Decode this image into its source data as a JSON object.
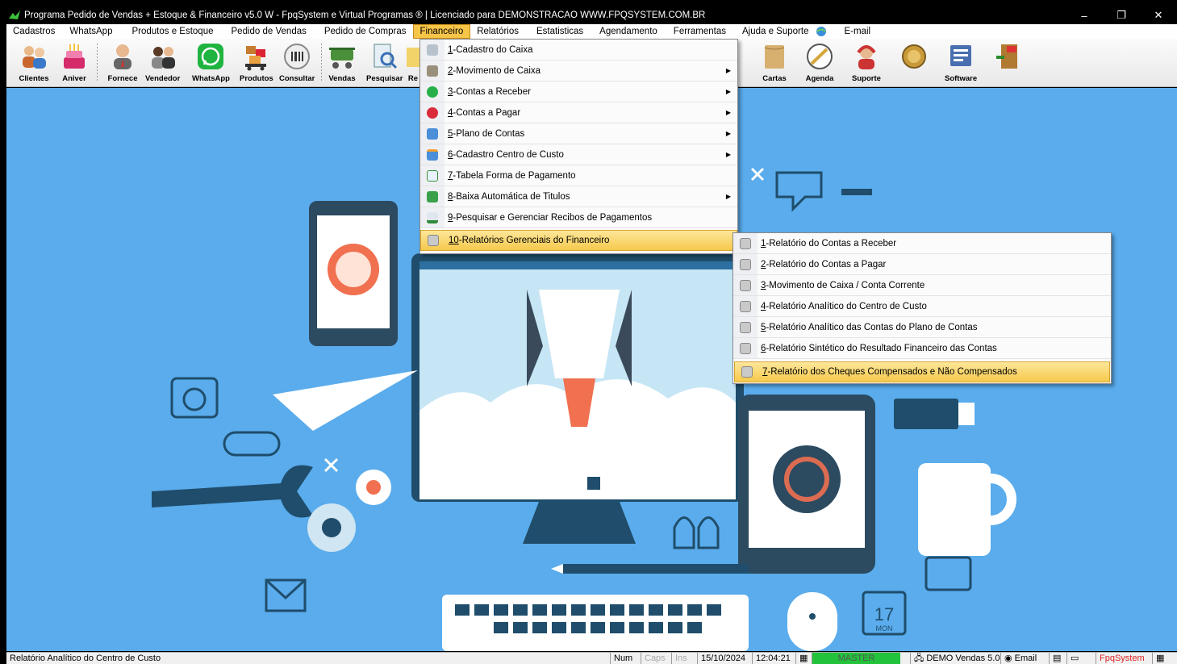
{
  "window": {
    "title": "Programa Pedido de Vendas + Estoque & Financeiro v5.0 W - FpqSystem e Virtual Programas ® | Licenciado para  DEMONSTRACAO WWW.FPQSYSTEM.COM.BR",
    "minimize": "–",
    "maximize": "❐",
    "close": "✕"
  },
  "menubar": [
    {
      "label": "Cadastros"
    },
    {
      "label": "WhatsApp"
    },
    {
      "label": "Produtos e Estoque"
    },
    {
      "label": "Pedido de Vendas"
    },
    {
      "label": "Pedido de Compras"
    },
    {
      "label": "Financeiro"
    },
    {
      "label": "Relatórios"
    },
    {
      "label": "Estatisticas"
    },
    {
      "label": "Agendamento"
    },
    {
      "label": "Ferramentas"
    },
    {
      "label": "Ajuda e Suporte"
    },
    {
      "label": "E-mail"
    }
  ],
  "toolbar": [
    {
      "label": "Clientes",
      "icon": "clients-icon"
    },
    {
      "label": "Aniver",
      "icon": "birthday-cake-icon"
    },
    {
      "label": "Fornece",
      "icon": "supplier-icon"
    },
    {
      "label": "Vendedor",
      "icon": "salesperson-icon"
    },
    {
      "label": "WhatsApp",
      "icon": "whatsapp-icon"
    },
    {
      "label": "Produtos",
      "icon": "products-icon"
    },
    {
      "label": "Consultar",
      "icon": "barcode-search-icon"
    },
    {
      "label": "Vendas",
      "icon": "cart-icon"
    },
    {
      "label": "Pesquisar",
      "icon": "search-doc-icon"
    },
    {
      "label": "Re",
      "icon": "report-icon"
    },
    {
      "label": "Cartas",
      "icon": "letters-icon"
    },
    {
      "label": "Agenda",
      "icon": "agenda-icon"
    },
    {
      "label": "Suporte",
      "icon": "support-icon"
    },
    {
      "label": "",
      "icon": "coin-icon"
    },
    {
      "label": "Software",
      "icon": "software-icon"
    },
    {
      "label": "",
      "icon": "exit-icon"
    }
  ],
  "financeiro_menu": [
    {
      "num": "1",
      "text": "-Cadastro do Caixa",
      "submenu": false
    },
    {
      "num": "2",
      "text": "-Movimento de Caixa",
      "submenu": true
    },
    {
      "num": "3",
      "text": "-Contas a Receber",
      "submenu": true
    },
    {
      "num": "4",
      "text": "-Contas a Pagar",
      "submenu": true
    },
    {
      "num": "5",
      "text": "-Plano de Contas",
      "submenu": true
    },
    {
      "num": "6",
      "text": "-Cadastro Centro de Custo",
      "submenu": true
    },
    {
      "num": "7",
      "text": "-Tabela Forma de Pagamento",
      "submenu": false
    },
    {
      "num": "8",
      "text": "-Baixa Automática de Titulos",
      "submenu": true
    },
    {
      "num": "9",
      "text": "-Pesquisar e Gerenciar Recibos de Pagamentos",
      "submenu": false
    },
    {
      "num": "10",
      "text": "-Relatórios Gerenciais do Financeiro",
      "submenu": false
    }
  ],
  "relatorios_submenu": [
    {
      "num": "1",
      "text": "-Relatório do Contas a Receber"
    },
    {
      "num": "2",
      "text": "-Relatório do Contas a Pagar"
    },
    {
      "num": "3",
      "text": "-Movimento de Caixa / Conta Corrente"
    },
    {
      "num": "4",
      "text": "-Relatório Analítico do Centro de Custo"
    },
    {
      "num": "5",
      "text": "-Relatório Analítico das Contas do Plano de Contas"
    },
    {
      "num": "6",
      "text": "-Relatório Sintético do Resultado Financeiro das Contas"
    },
    {
      "num": "7",
      "text": "-Relatório dos Cheques Compensados e Não Compensados"
    }
  ],
  "background": {
    "calendar_day": "17",
    "calendar_weekday": "MON"
  },
  "statusbar": {
    "message": "Relatório Analítico do Centro de Custo",
    "num": "Num",
    "caps": "Caps",
    "ins": "Ins",
    "date": "15/10/2024",
    "time": "12:04:21",
    "user": "MASTER",
    "version": "DEMO Vendas 5.0",
    "email": "Email",
    "brand": "FpqSystem"
  }
}
